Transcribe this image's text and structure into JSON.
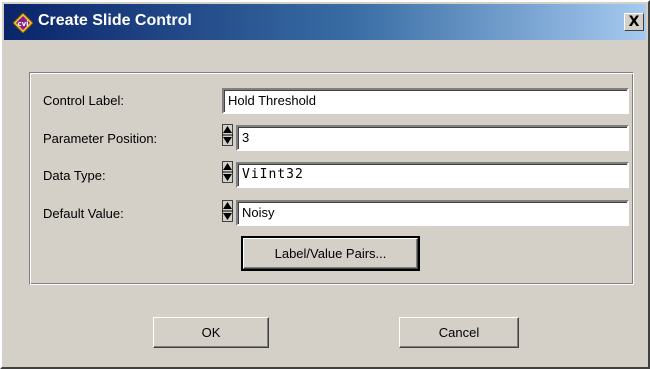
{
  "window": {
    "title": "Create Slide Control",
    "close_glyph": "X",
    "app_icon": "cvi-icon"
  },
  "form": {
    "control_label": {
      "label": "Control Label:",
      "value": "Hold Threshold"
    },
    "parameter_position": {
      "label": "Parameter Position:",
      "value": "3"
    },
    "data_type": {
      "label": "Data Type:",
      "value": "ViInt32"
    },
    "default_value": {
      "label": "Default Value:",
      "value": "Noisy"
    },
    "pairs_button": "Label/Value Pairs..."
  },
  "buttons": {
    "ok": "OK",
    "cancel": "Cancel"
  },
  "colors": {
    "title_start": "#0a246a",
    "title_end": "#a6caf0",
    "face": "#d4d0c8"
  }
}
